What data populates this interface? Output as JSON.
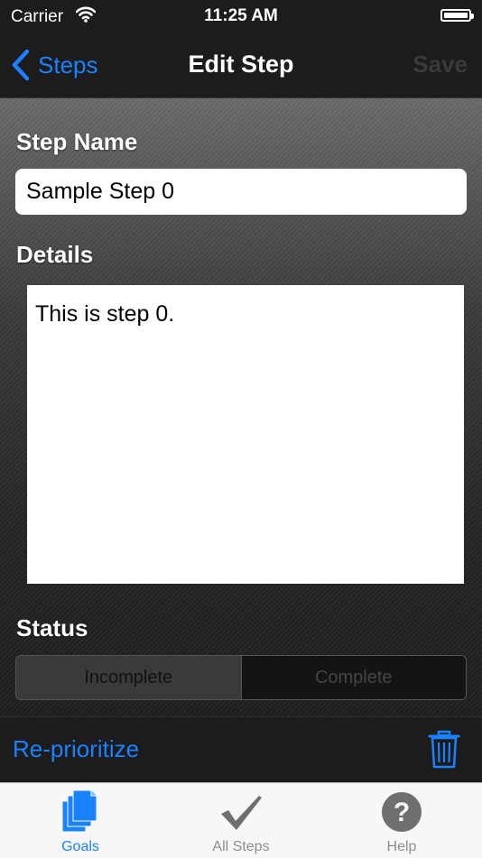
{
  "status_bar": {
    "carrier": "Carrier",
    "time": "11:25 AM"
  },
  "nav": {
    "back_label": "Steps",
    "title": "Edit Step",
    "save_label": "Save"
  },
  "form": {
    "step_name_label": "Step Name",
    "step_name_value": "Sample Step 0",
    "details_label": "Details",
    "details_value": "This is step 0.",
    "status_label": "Status",
    "status_options": [
      "Incomplete",
      "Complete"
    ],
    "status_selected": "Incomplete"
  },
  "toolbar": {
    "reprioritize_label": "Re-prioritize",
    "trash_icon": "trash-icon"
  },
  "tabs": [
    {
      "label": "Goals",
      "icon": "documents-icon",
      "active": true
    },
    {
      "label": "All Steps",
      "icon": "checkmark-icon",
      "active": false
    },
    {
      "label": "Help",
      "icon": "question-icon",
      "active": false
    }
  ],
  "colors": {
    "accent": "#1a82ff",
    "bar_bg": "#1c1c1c",
    "tab_bg": "#f7f7f7"
  }
}
